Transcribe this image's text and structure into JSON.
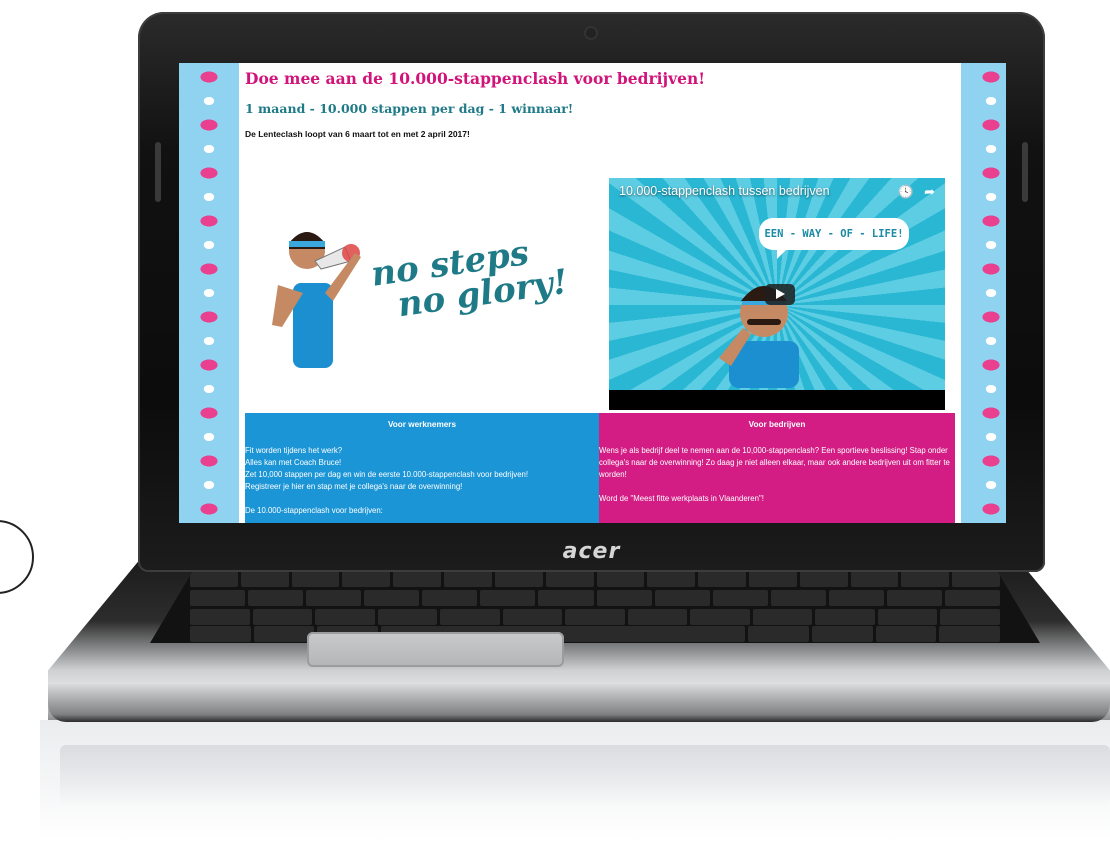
{
  "laptop": {
    "brand": "acer"
  },
  "page": {
    "heading": "Doe mee aan de 10.000-stappenclash voor bedrijven!",
    "subheading": "1 maand - 10.000 stappen per dag - 1 winnaar!",
    "dates": "De Lenteclash loopt van 6 maart tot en met 2 april 2017!",
    "slogan_line1": "no steps",
    "slogan_line2": "no glory!"
  },
  "video": {
    "title": "10.000-stappenclash tussen bedrijven",
    "bubble": "EEN - WAY - OF - LIFE!",
    "icons": [
      "clock-icon",
      "share-icon"
    ]
  },
  "employees": {
    "title": "Voor werknemers",
    "lines": [
      "Fit worden tijdens het werk?",
      "Alles kan met Coach Bruce!",
      "Zet 10,000 stappen per dag en win de eerste 10.000-stappenclash voor bedrijven!",
      "Registreer je hier en stap met je collega's naar de overwinning!",
      "De 10.000-stappenclash voor bedrijven:"
    ]
  },
  "companies": {
    "title": "Voor bedrijven",
    "lines": [
      "Wens je als bedrijf deel te nemen aan de 10,000-stappenclash? Een sportieve beslissing! Stap onder collega's naar de overwinning! Zo daag je niet alleen elkaar, maar ook andere bedrijven uit om fitter te worden!",
      "Word de \"Meest fitte werkplaats in Vlaanderen\"!"
    ]
  },
  "colors": {
    "accent_pink": "#d2147a",
    "teal": "#1e7a86",
    "panel_blue": "#1b95d6",
    "panel_pink": "#d31d84",
    "tile_blue": "#8fd3f0"
  }
}
